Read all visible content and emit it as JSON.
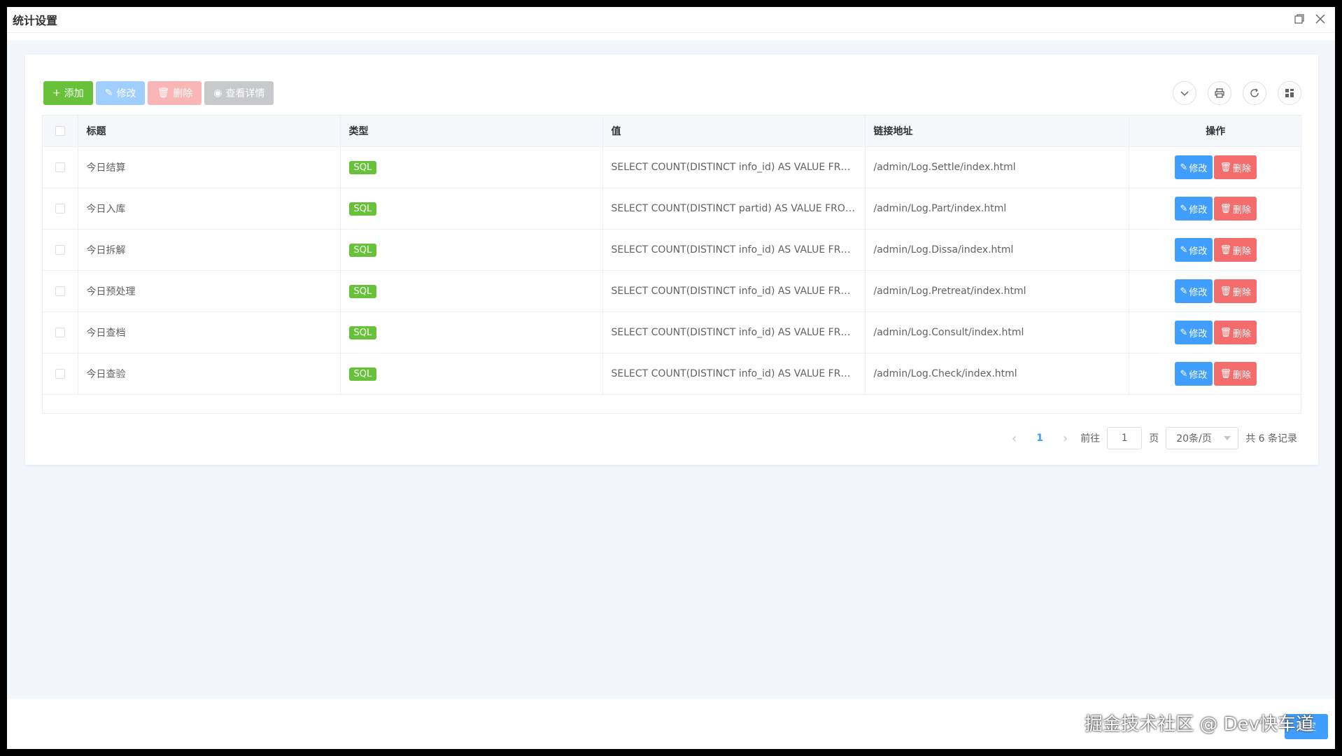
{
  "window": {
    "title": "统计设置"
  },
  "toolbar": {
    "add_label": "添加",
    "edit_label": "修改",
    "delete_label": "删除",
    "view_label": "查看详情"
  },
  "table": {
    "columns": [
      "标题",
      "类型",
      "值",
      "链接地址",
      "操作"
    ],
    "rows": [
      {
        "title": "今日结算",
        "type": "SQL",
        "value": "SELECT COUNT(DISTINCT info_id) AS VALUE FROM...",
        "url": "/admin/Log.Settle/index.html"
      },
      {
        "title": "今日入库",
        "type": "SQL",
        "value": "SELECT COUNT(DISTINCT partid) AS VALUE FROM ...",
        "url": "/admin/Log.Part/index.html"
      },
      {
        "title": "今日拆解",
        "type": "SQL",
        "value": "SELECT COUNT(DISTINCT info_id) AS VALUE FROM...",
        "url": "/admin/Log.Dissa/index.html"
      },
      {
        "title": "今日预处理",
        "type": "SQL",
        "value": "SELECT COUNT(DISTINCT info_id) AS VALUE FROM...",
        "url": "/admin/Log.Pretreat/index.html"
      },
      {
        "title": "今日查档",
        "type": "SQL",
        "value": "SELECT COUNT(DISTINCT info_id) AS VALUE FROM...",
        "url": "/admin/Log.Consult/index.html"
      },
      {
        "title": "今日查验",
        "type": "SQL",
        "value": "SELECT COUNT(DISTINCT info_id) AS VALUE FROM...",
        "url": "/admin/Log.Check/index.html"
      }
    ],
    "row_edit_label": "修改",
    "row_delete_label": "删除"
  },
  "pagination": {
    "current_page": "1",
    "goto_label": "前往",
    "goto_value": "1",
    "page_suffix": "页",
    "page_size": "20条/页",
    "total_text": "共 6 条记录"
  },
  "footer": {
    "confirm_label": "确定",
    "watermark": "掘金技术社区 @ Dev快车道"
  },
  "colors": {
    "primary": "#409eff",
    "success": "#67c23a",
    "danger": "#f56c6c"
  }
}
